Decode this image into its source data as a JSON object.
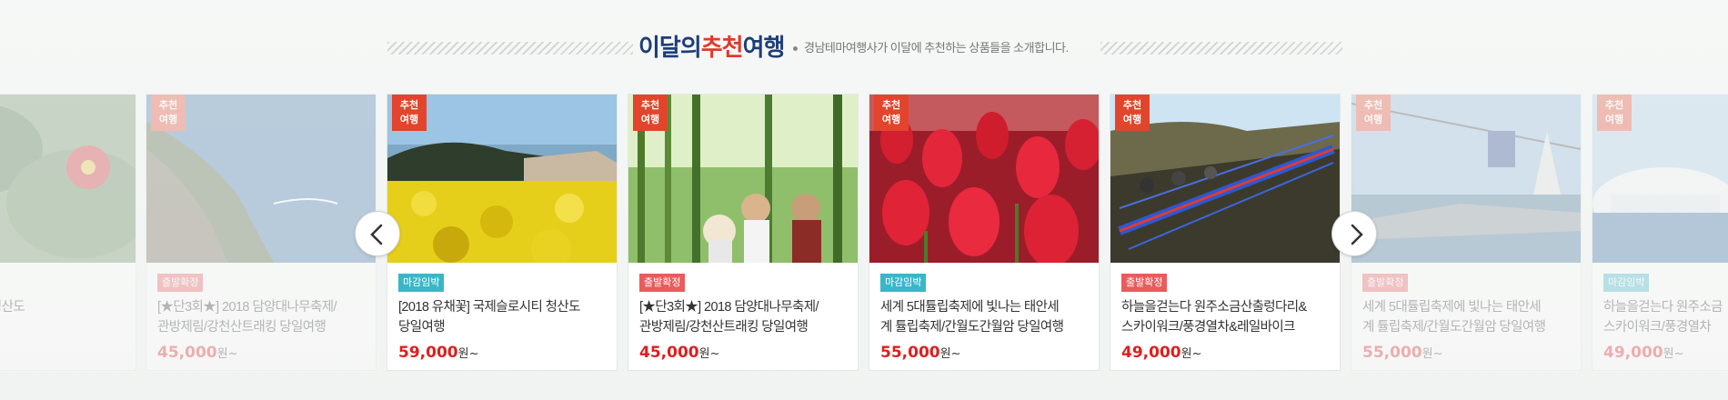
{
  "header": {
    "title_part1": "이달의",
    "title_part2": "추천",
    "title_part3": "여행",
    "subtitle": "경남테마여행사가 이달에 추천하는 상품들을 소개합니다."
  },
  "carousel": {
    "prev_icon": "chevron-left-icon",
    "next_icon": "chevron-right-icon",
    "badge_line1": "추천",
    "badge_line2": "여행",
    "price_unit": "원~",
    "cards": [
      {
        "status": "",
        "name_line1": "국제슬로시티 청산도",
        "name_line2": "",
        "price": "",
        "image": "camellia-flower",
        "faded": true
      },
      {
        "status": "출발확정",
        "name_line1": "[★단3회★] 2018 담양대나무축제/",
        "name_line2": "관방제림/강천산트래킹 당일여행",
        "price": "45,000",
        "image": "island-coast-aerial",
        "faded": true
      },
      {
        "status": "마감임박",
        "name_line1": "[2018 유채꽃] 국제슬로시티 청산도",
        "name_line2": "당일여행",
        "price": "59,000",
        "image": "rapeseed-flower-field",
        "faded": false
      },
      {
        "status": "출발확정",
        "name_line1": "[★단3회★] 2018 담양대나무축제/",
        "name_line2": "관방제림/강천산트래킹 당일여행",
        "price": "45,000",
        "image": "bamboo-forest-tourists",
        "faded": false
      },
      {
        "status": "마감임박",
        "name_line1": "세계 5대튤립축제에 빛나는 태안세",
        "name_line2": "계 튤립축제/간월도간월암 당일여행",
        "price": "55,000",
        "image": "red-tulips",
        "faded": false
      },
      {
        "status": "출발확정",
        "name_line1": "하늘을걷는다 원주소금산출렁다리&",
        "name_line2": "스카이워크/풍경열차&레일바이크",
        "price": "49,000",
        "image": "suspension-bridge",
        "faded": false
      },
      {
        "status": "출발확정",
        "name_line1": "세계 5대튤립축제에 빛나는 태안세",
        "name_line2": "계 튤립축제/간월도간월암 당일여행",
        "price": "55,000",
        "image": "cable-car-harbor",
        "faded": true
      },
      {
        "status": "마감임박",
        "name_line1": "하늘을걷는다 원주소금",
        "name_line2": "스카이워크/풍경열차",
        "price": "49,000",
        "image": "white-dome-building",
        "faded": true
      }
    ]
  }
}
